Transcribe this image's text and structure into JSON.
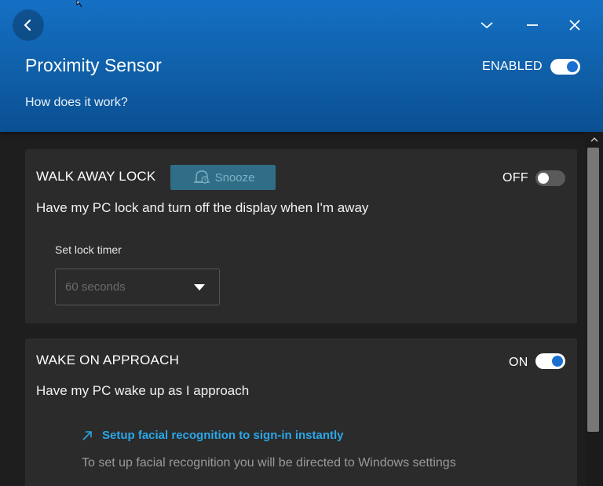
{
  "header": {
    "title": "Proximity Sensor",
    "enabled_label": "ENABLED",
    "enabled_state": true,
    "help_link": "How does it work?",
    "icons": [
      "back-arrow-icon",
      "chevron-down-icon",
      "minimize-icon",
      "close-icon"
    ]
  },
  "walk_away": {
    "title": "WALK AWAY LOCK",
    "snooze_label": "Snooze",
    "state_label": "OFF",
    "state": false,
    "description": "Have my PC lock and turn off the display when I'm away",
    "timer_label": "Set lock timer",
    "timer_value": "60 seconds"
  },
  "wake": {
    "title": "WAKE ON APPROACH",
    "state_label": "ON",
    "state": true,
    "description": "Have my PC wake up as I approach",
    "facial_link": "Setup facial recognition to sign-in instantly",
    "facial_note": "To set up facial recognition you will be directed to Windows settings"
  },
  "colors": {
    "header_blue": "#1570c4",
    "accent": "#1a6fd0",
    "link": "#2aa7e8",
    "card_bg": "#2b2b2b"
  }
}
